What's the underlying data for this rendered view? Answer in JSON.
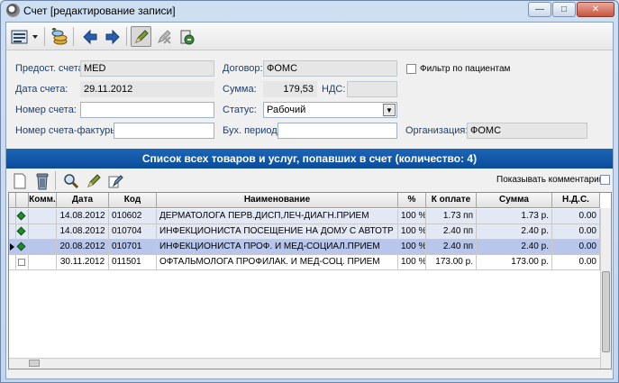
{
  "window": {
    "title": "Счет [редактирование записи]"
  },
  "form": {
    "provider_label": "Предост. счета:",
    "provider_value": "MED",
    "contract_label": "Договор:",
    "contract_value": "ФОМС",
    "patient_filter_label": "Фильтр по пациентам",
    "date_label": "Дата счета:",
    "date_value": "29.11.2012",
    "sum_label": "Сумма:",
    "sum_value": "179,53",
    "vat_label": "НДС:",
    "vat_value": "",
    "number_label": "Номер счета:",
    "number_value": "",
    "status_label": "Статус:",
    "status_value": "Рабочий",
    "invoice_number_label": "Номер счета-фактуры:",
    "invoice_number_value": "",
    "period_label": "Бух. период:",
    "period_value": "",
    "org_label": "Организация:",
    "org_value": "ФОМС"
  },
  "list": {
    "banner": "Список всех товаров и услуг, попавших в счет (количество: 4)",
    "show_comments_label": "Показывать комментарии",
    "columns": [
      "Комм.",
      "Дата",
      "Код",
      "Наименование",
      "%",
      "К оплате",
      "Сумма",
      "Н.Д.С."
    ],
    "rows": [
      {
        "date": "14.08.2012",
        "code": "010602",
        "name": "ДЕРМАТОЛОГА ПЕРВ.ДИСП,ЛЕЧ-ДИАГН.ПРИЕМ",
        "pct": "100 %",
        "topay": "1.73 пп",
        "sum": "1.73 р.",
        "vat": "0.00",
        "marker": "diamond",
        "current": false,
        "selected": false
      },
      {
        "date": "14.08.2012",
        "code": "010704",
        "name": "ИНФЕКЦИОНИСТА ПОСЕЩЕНИЕ НА ДОМУ С АВТОТР",
        "pct": "100 %",
        "topay": "2.40 пп",
        "sum": "2.40 р.",
        "vat": "0.00",
        "marker": "diamond",
        "current": false,
        "selected": false
      },
      {
        "date": "20.08.2012",
        "code": "010701",
        "name": "ИНФЕКЦИОНИСТА ПРОФ. И МЕД-СОЦИАЛ.ПРИЕМ",
        "pct": "100 %",
        "topay": "2.40 пп",
        "sum": "2.40 р.",
        "vat": "0.00",
        "marker": "diamond",
        "current": true,
        "selected": true
      },
      {
        "date": "30.11.2012",
        "code": "011501",
        "name": "ОФТАЛЬМОЛОГА ПРОФИЛАК. И МЕД-СОЦ. ПРИЕМ",
        "pct": "100 %",
        "topay": "173.00 р.",
        "sum": "173.00 р.",
        "vat": "0.00",
        "marker": "checkbox",
        "current": false,
        "selected": false
      }
    ]
  },
  "colors": {
    "banner": "#0b4c9c",
    "selected_row": "#b7c6ea",
    "row_alt": "#e3e8f5",
    "label": "#1d3f6d"
  }
}
